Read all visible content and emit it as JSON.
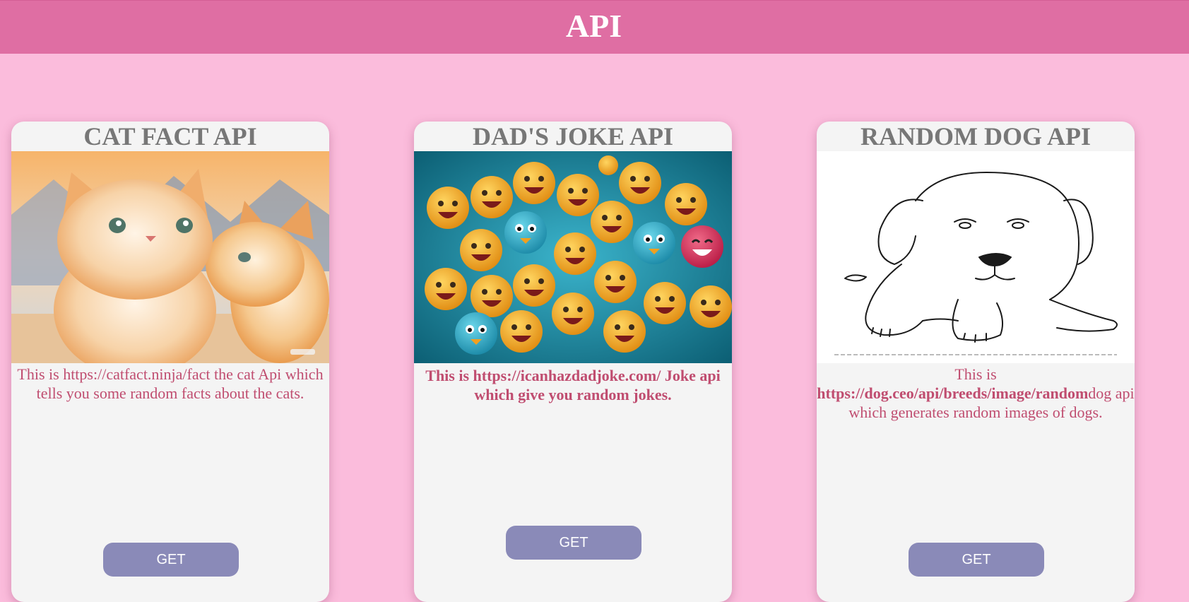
{
  "header": {
    "title": "API"
  },
  "cards": [
    {
      "title": "CAT FACT API",
      "image": "kittens-illustration",
      "desc_prefix": "This is https://catfact.ninja/fact the cat Api which tells you some random facts about the cats.",
      "button": "GET"
    },
    {
      "title": "DAD'S JOKE API",
      "image": "emoji-faces-illustration",
      "desc_prefix": "This is https://icanhazdadjoke.com/ Joke api which give you random jokes.",
      "button": "GET"
    },
    {
      "title": "RANDOM DOG API",
      "image": "dog-sketch-illustration",
      "desc_prefix": "This is ",
      "desc_url": "https://dog.ceo/api/breeds/image/random",
      "desc_suffix": "dog api which generates random images of dogs.",
      "button": "GET"
    }
  ],
  "colors": {
    "page_background": "#fbbcdc",
    "header_background": "#df6ea3",
    "card_background": "#f4f4f4",
    "card_title": "#777777",
    "description_text": "#c04d70",
    "button_background": "#8a8ab8"
  }
}
